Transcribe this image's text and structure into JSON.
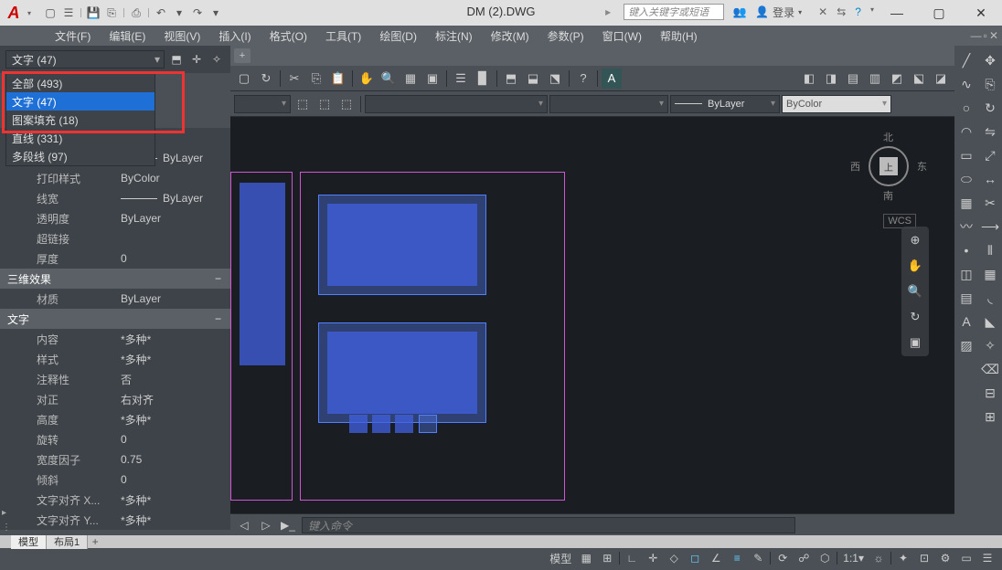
{
  "app": {
    "title": "DM (2).DWG",
    "search_placeholder": "键入关键字或短语",
    "login_label": "登录"
  },
  "menus": [
    "文件(F)",
    "编辑(E)",
    "视图(V)",
    "插入(I)",
    "格式(O)",
    "工具(T)",
    "绘图(D)",
    "标注(N)",
    "修改(M)",
    "参数(P)",
    "窗口(W)",
    "帮助(H)"
  ],
  "properties": {
    "selector_value": "文字 (47)",
    "dropdown_items": [
      "全部 (493)",
      "文字 (47)",
      "图案填充 (18)",
      "直线 (331)",
      "多段线 (97)"
    ],
    "dropdown_selected": 1,
    "groups": [
      {
        "name": "",
        "rows": [
          {
            "label": "",
            "value": "ayer"
          },
          {
            "label": "",
            "value": "ByLayer",
            "line": true
          },
          {
            "label": "打印样式",
            "value": "ByColor"
          },
          {
            "label": "线宽",
            "value": "ByLayer",
            "line": true
          },
          {
            "label": "透明度",
            "value": "ByLayer"
          },
          {
            "label": "超链接",
            "value": ""
          },
          {
            "label": "厚度",
            "value": "0"
          }
        ]
      },
      {
        "name": "三维效果",
        "rows": [
          {
            "label": "材质",
            "value": "ByLayer"
          }
        ]
      },
      {
        "name": "文字",
        "rows": [
          {
            "label": "内容",
            "value": "*多种*"
          },
          {
            "label": "样式",
            "value": "*多种*"
          },
          {
            "label": "注释性",
            "value": "否"
          },
          {
            "label": "对正",
            "value": "右对齐"
          },
          {
            "label": "高度",
            "value": "*多种*"
          },
          {
            "label": "旋转",
            "value": "0"
          },
          {
            "label": "宽度因子",
            "value": "0.75"
          },
          {
            "label": "倾斜",
            "value": "0"
          },
          {
            "label": "文字对齐 X...",
            "value": "*多种*"
          },
          {
            "label": "文字对齐 Y...",
            "value": "*多种*"
          }
        ]
      }
    ]
  },
  "layer_toolbar": {
    "bylayer1": "ByLayer",
    "bycolor": "ByColor"
  },
  "cmd": {
    "placeholder": "键入命令"
  },
  "compass": {
    "n": "北",
    "s": "南",
    "e": "东",
    "w": "西",
    "top": "上"
  },
  "wcs": "WCS",
  "bottom_tabs": [
    "模型",
    "布局1"
  ],
  "status": {
    "model": "模型",
    "scale": "1:1"
  }
}
